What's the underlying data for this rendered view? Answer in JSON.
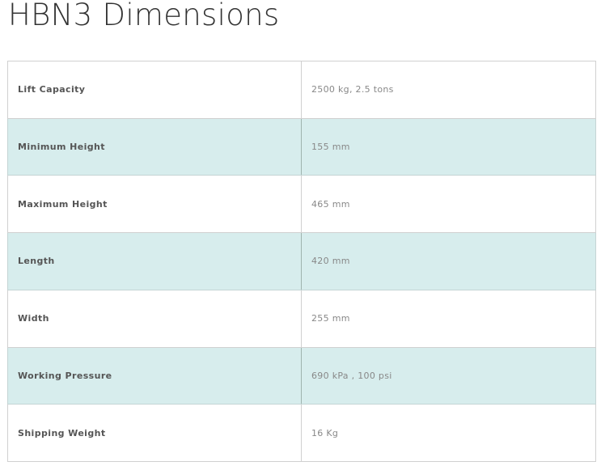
{
  "page": {
    "title": "HBN3 Dimensions"
  },
  "specs": {
    "rows": [
      {
        "label": "Lift Capacity",
        "value": "2500 kg, 2.5 tons"
      },
      {
        "label": "Minimum Height",
        "value": "155 mm"
      },
      {
        "label": "Maximum Height",
        "value": "465 mm"
      },
      {
        "label": "Length",
        "value": "420 mm"
      },
      {
        "label": "Width",
        "value": "255 mm"
      },
      {
        "label": "Working Pressure",
        "value": "690 kPa , 100 psi"
      },
      {
        "label": "Shipping Weight",
        "value": "16 Kg"
      }
    ]
  },
  "colors": {
    "row_shade": "#d7eded",
    "label_text": "#555555",
    "value_text": "#888888",
    "border": "#d0d0d0"
  }
}
